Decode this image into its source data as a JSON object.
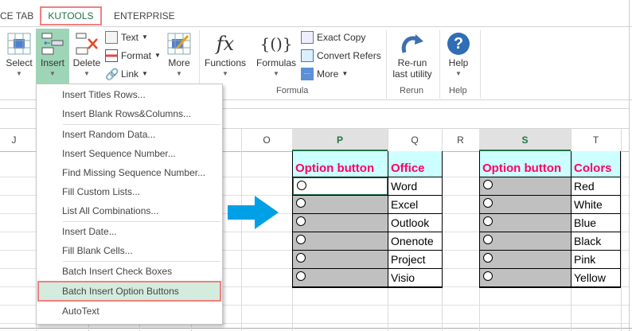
{
  "tabs": [
    {
      "label": "CE TAB"
    },
    {
      "label": "KUTOOLS",
      "active": true
    },
    {
      "label": "ENTERPRISE"
    }
  ],
  "ribbon": {
    "select": "Select",
    "insert": "Insert",
    "delete": "Delete",
    "text": "Text",
    "format": "Format",
    "link": "Link",
    "more": "More",
    "functions": "Functions",
    "formulas": "Formulas",
    "exact_copy": "Exact Copy",
    "convert_refers": "Convert Refers",
    "more2": "More",
    "rerun_line1": "Re-run",
    "rerun_line2": "last utility",
    "help": "Help",
    "groups": {
      "formula": "Formula",
      "rerun": "Rerun",
      "help": "Help"
    }
  },
  "menu": {
    "items": [
      "Insert Titles Rows...",
      "Insert Blank Rows&Columns...",
      "Insert Random Data...",
      "Insert Sequence Number...",
      "Find Missing Sequence Number...",
      "Fill Custom Lists...",
      "List All Combinations...",
      "Insert Date...",
      "Fill Blank Cells...",
      "Batch Insert Check Boxes",
      "Batch Insert Option Buttons",
      "AutoText"
    ],
    "highlighted": "Batch Insert Option Buttons"
  },
  "columns": [
    "J",
    "O",
    "P",
    "Q",
    "R",
    "S",
    "T"
  ],
  "table1": {
    "header": [
      "Option button",
      "Office"
    ],
    "values": [
      "Word",
      "Excel",
      "Outlook",
      "Onenote",
      "Project",
      "Visio"
    ]
  },
  "table2": {
    "header": [
      "Option button",
      "Colors"
    ],
    "values": [
      "Red",
      "White",
      "Blue",
      "Black",
      "Pink",
      "Yellow"
    ]
  },
  "colors": {
    "accent": "#217346",
    "header_text": "#ff0066",
    "header_fill": "#ccffff",
    "arrow": "#00a0e6",
    "highlight": "#f08080"
  }
}
